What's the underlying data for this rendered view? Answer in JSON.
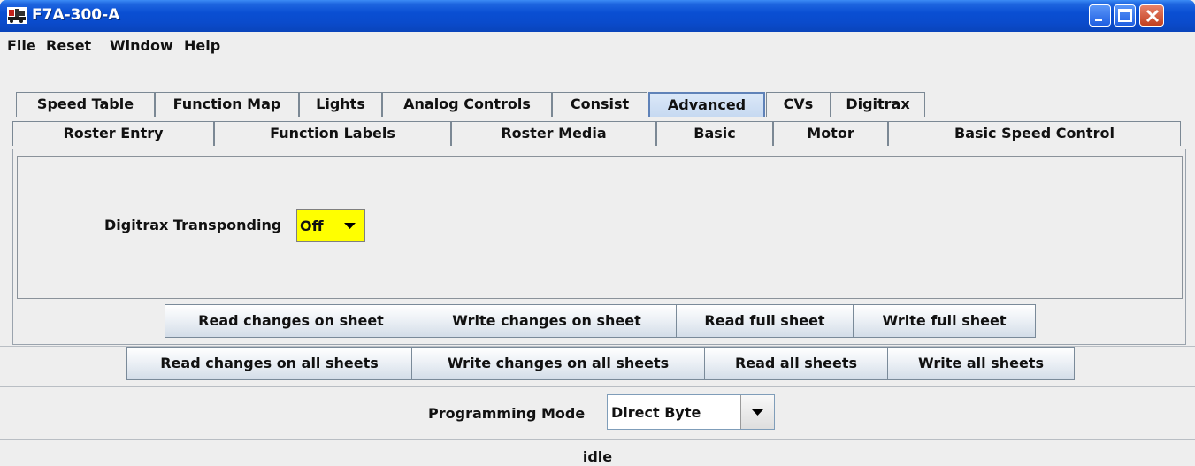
{
  "window": {
    "title": "F7A-300-A",
    "icon": "train-icon",
    "controls": [
      "minimize-icon",
      "maximize-icon",
      "close-icon"
    ]
  },
  "menu": [
    "File",
    "Reset",
    "Window",
    "Help"
  ],
  "tabs_row1": [
    "Speed Table",
    "Function Map",
    "Lights",
    "Analog Controls",
    "Consist",
    "Advanced",
    "CVs",
    "Digitrax"
  ],
  "tabs_row2": [
    "Roster Entry",
    "Function Labels",
    "Roster Media",
    "Basic",
    "Motor",
    "Basic Speed Control"
  ],
  "selected_tab": "Advanced",
  "panel": {
    "transponding_label": "Digitrax Transponding",
    "transponding_value": "Off"
  },
  "sheet_buttons": [
    "Read changes on sheet",
    "Write changes on sheet",
    "Read full sheet",
    "Write full sheet"
  ],
  "all_buttons": [
    "Read changes on all sheets",
    "Write changes on all sheets",
    "Read all sheets",
    "Write all sheets"
  ],
  "programming": {
    "label": "Programming Mode",
    "value": "Direct Byte"
  },
  "status": "idle",
  "colors": {
    "titlebar": "#0a4fd3",
    "highlight": "#ffff00",
    "background": "#eeeeee"
  }
}
